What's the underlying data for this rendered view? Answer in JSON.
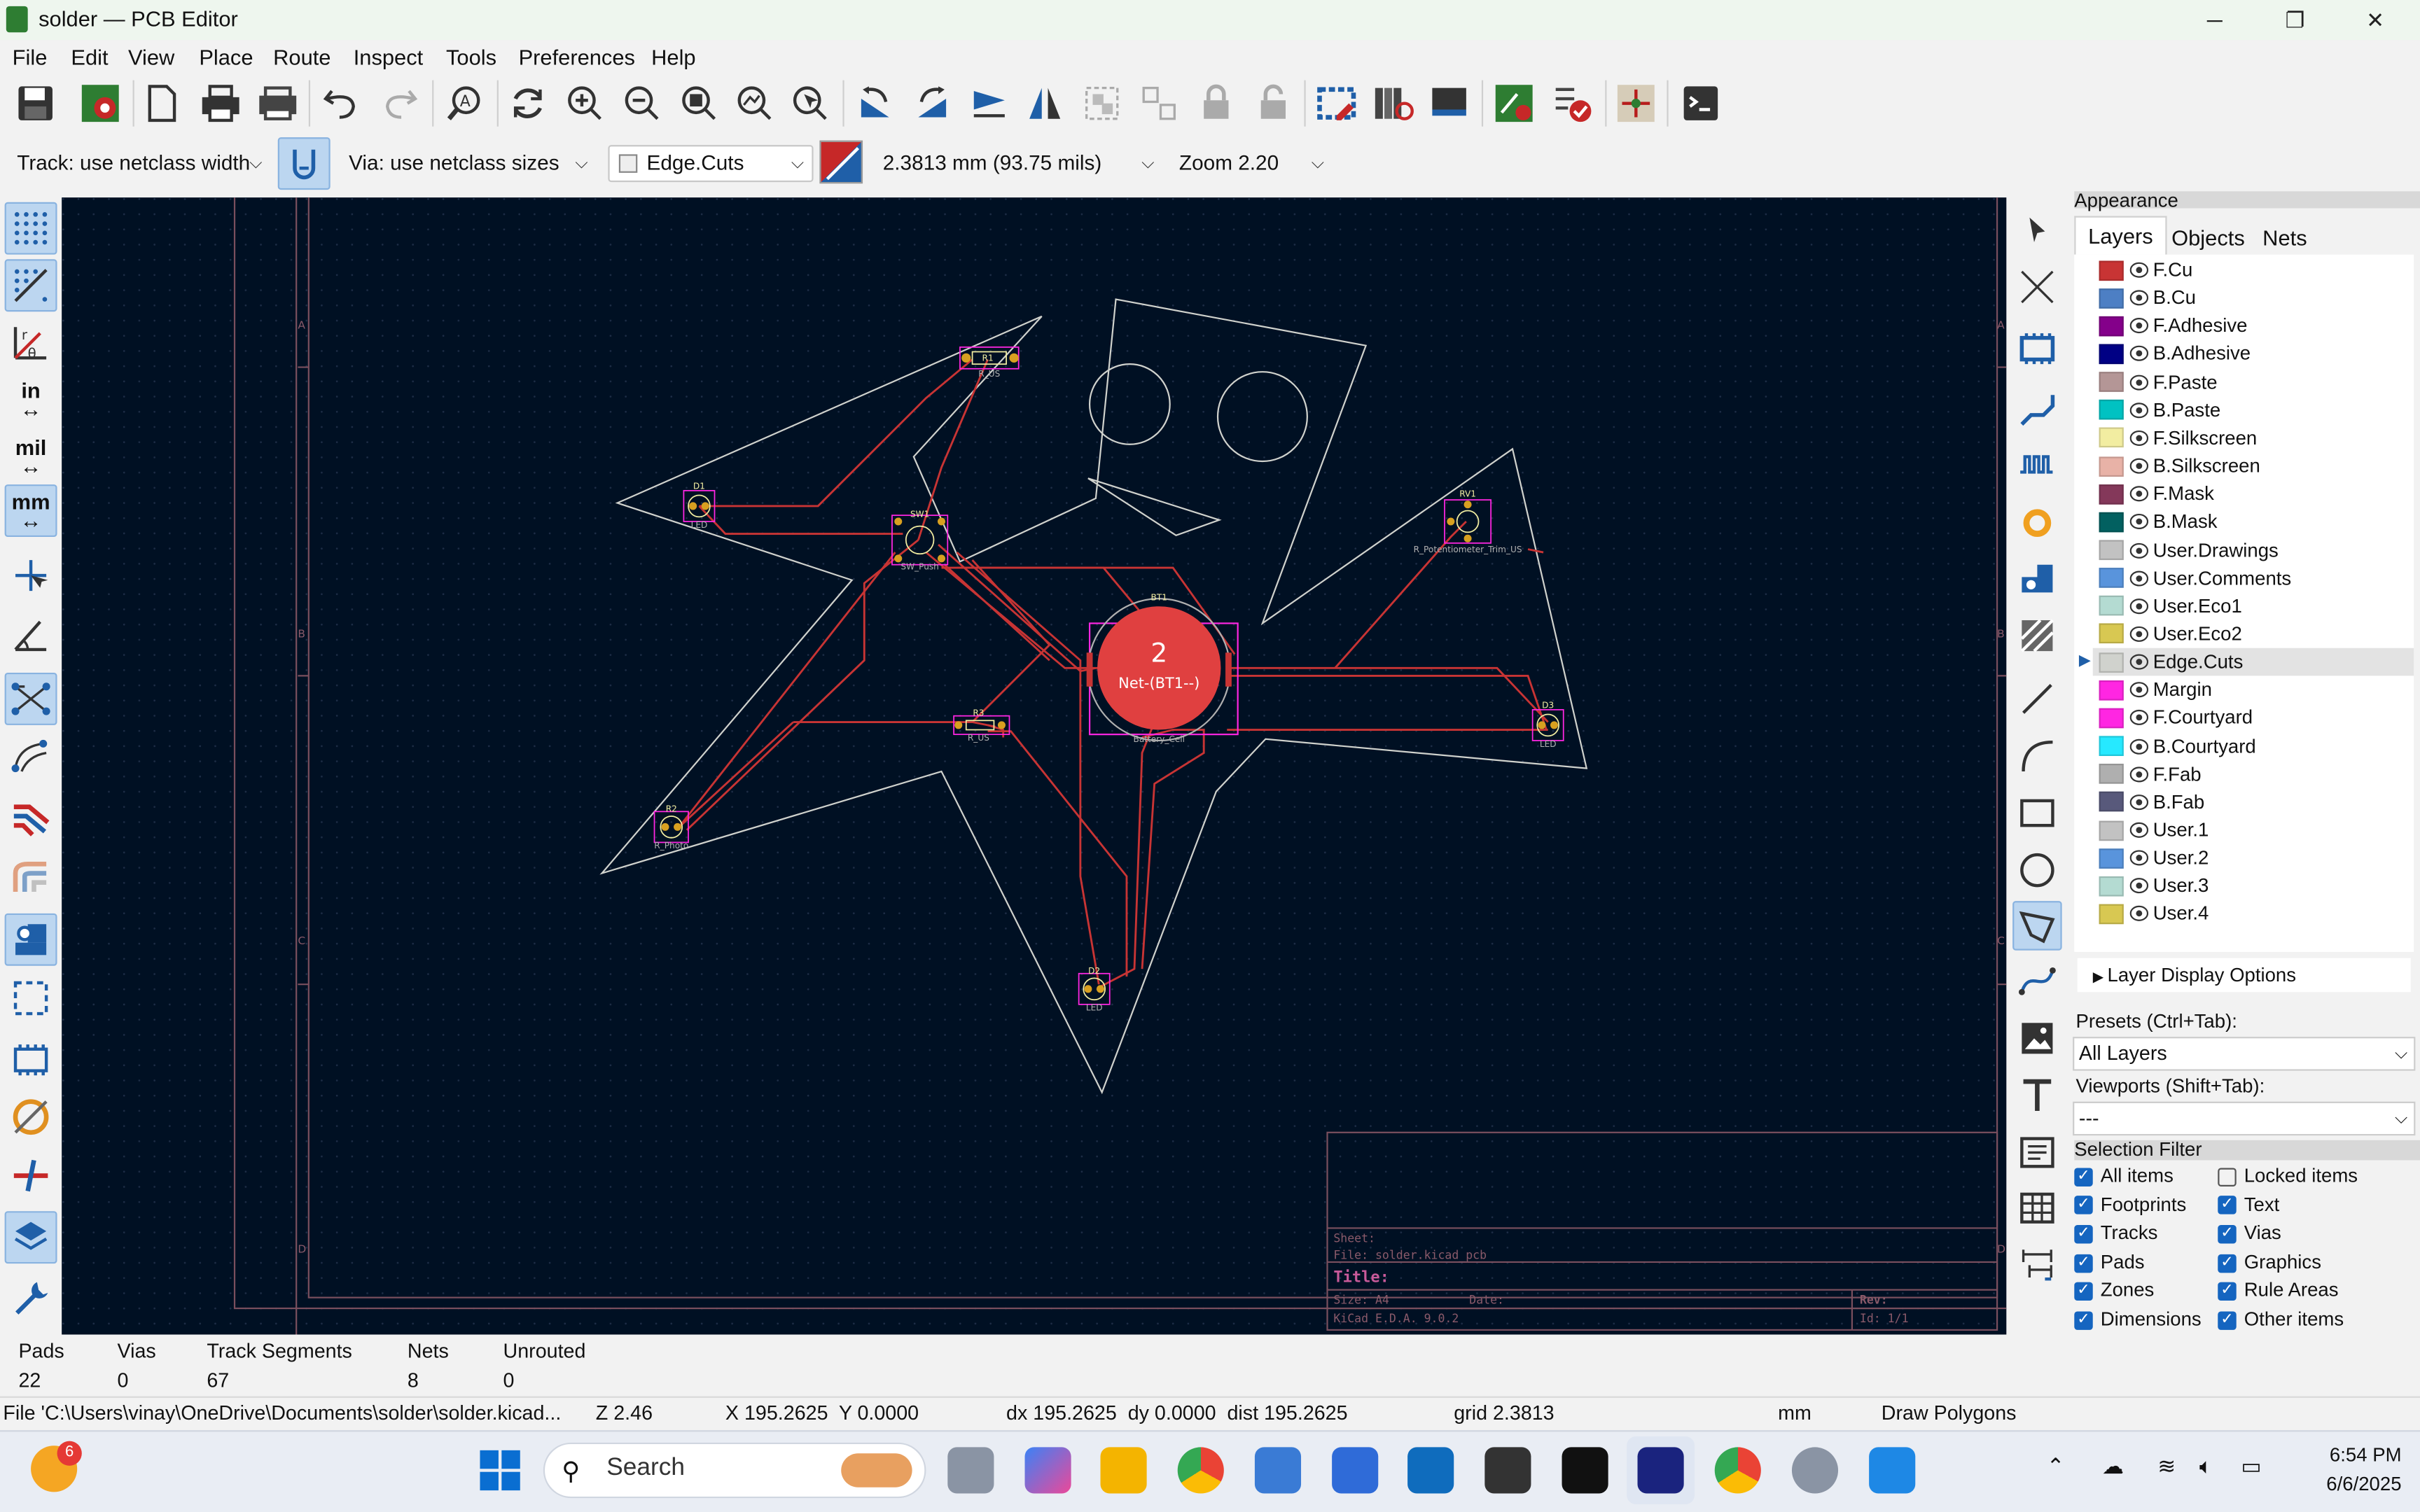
{
  "window": {
    "title": "solder — PCB Editor",
    "minimize": "─",
    "maximize": "❐",
    "close": "✕"
  },
  "menu": [
    "File",
    "Edit",
    "View",
    "Place",
    "Route",
    "Inspect",
    "Tools",
    "Preferences",
    "Help"
  ],
  "toolbar": {
    "track_width": "Track: use netclass width",
    "via_size": "Via: use netclass sizes",
    "layer": "Edge.Cuts",
    "grid": "2.3813 mm (93.75 mils)",
    "zoom": "Zoom 2.20"
  },
  "left_tools": {
    "units_in": "in",
    "units_mil": "mil",
    "units_mm": "mm"
  },
  "board": {
    "refs": {
      "r1": "R1",
      "r1v": "R_US",
      "d1": "D1",
      "d1v": "LED",
      "sw1": "SW1",
      "sw1v": "SW_Push",
      "bt1": "BT1",
      "bt1v": "Battery_Cell",
      "rv1": "RV1",
      "rv1v": "R_Potentiometer_Trim_US",
      "r3": "R3",
      "r3v": "R_US",
      "d3": "D3",
      "d3v": "LED",
      "r2": "R2",
      "r2v": "R_Photo",
      "d2": "D2",
      "d2v": "LED"
    },
    "pad_number": "2",
    "pad_net": "Net-(BT1--)",
    "frame_rows": [
      "A",
      "B",
      "C",
      "D"
    ],
    "titleblock": {
      "sheet": "Sheet:",
      "file": "File: solder.kicad_pcb",
      "title": "Title:",
      "size": "Size: A4",
      "date": "Date:",
      "rev": "Rev:",
      "kicad": "KiCad E.D.A. 9.0.2",
      "id": "Id: 1/1"
    }
  },
  "appearance": {
    "header": "Appearance",
    "tabs": [
      "Layers",
      "Objects",
      "Nets"
    ],
    "layers": [
      {
        "name": "F.Cu",
        "color": "#c83434"
      },
      {
        "name": "B.Cu",
        "color": "#4d7fc4"
      },
      {
        "name": "F.Adhesive",
        "color": "#84008a"
      },
      {
        "name": "B.Adhesive",
        "color": "#000084"
      },
      {
        "name": "F.Paste",
        "color": "#b49696"
      },
      {
        "name": "B.Paste",
        "color": "#00c2c2"
      },
      {
        "name": "F.Silkscreen",
        "color": "#f2eda1"
      },
      {
        "name": "B.Silkscreen",
        "color": "#e8b2a7"
      },
      {
        "name": "F.Mask",
        "color": "#84385a"
      },
      {
        "name": "B.Mask",
        "color": "#026060"
      },
      {
        "name": "User.Drawings",
        "color": "#c2c2c2"
      },
      {
        "name": "User.Comments",
        "color": "#5994dc"
      },
      {
        "name": "User.Eco1",
        "color": "#b4dbd2"
      },
      {
        "name": "User.Eco2",
        "color": "#d8c852"
      },
      {
        "name": "Edge.Cuts",
        "color": "#d0d2cd"
      },
      {
        "name": "Margin",
        "color": "#ff26e2"
      },
      {
        "name": "F.Courtyard",
        "color": "#ff26e2"
      },
      {
        "name": "B.Courtyard",
        "color": "#26e9ff"
      },
      {
        "name": "F.Fab",
        "color": "#afafaf"
      },
      {
        "name": "B.Fab",
        "color": "#58597b"
      },
      {
        "name": "User.1",
        "color": "#c2c2c2"
      },
      {
        "name": "User.2",
        "color": "#5994dc"
      },
      {
        "name": "User.3",
        "color": "#b4dbd2"
      },
      {
        "name": "User.4",
        "color": "#d8c852"
      }
    ],
    "layer_display_options": "Layer Display Options",
    "presets_label": "Presets (Ctrl+Tab):",
    "presets_value": "All Layers",
    "viewports_label": "Viewports (Shift+Tab):",
    "viewports_value": "---",
    "selection_filter": "Selection Filter",
    "filters": [
      {
        "label": "All items",
        "checked": true
      },
      {
        "label": "Locked items",
        "checked": false
      },
      {
        "label": "Footprints",
        "checked": true
      },
      {
        "label": "Text",
        "checked": true
      },
      {
        "label": "Tracks",
        "checked": true
      },
      {
        "label": "Vias",
        "checked": true
      },
      {
        "label": "Pads",
        "checked": true
      },
      {
        "label": "Graphics",
        "checked": true
      },
      {
        "label": "Zones",
        "checked": true
      },
      {
        "label": "Rule Areas",
        "checked": true
      },
      {
        "label": "Dimensions",
        "checked": true
      },
      {
        "label": "Other items",
        "checked": true
      }
    ]
  },
  "stats": {
    "labels": [
      "Pads",
      "Vias",
      "Track Segments",
      "Nets",
      "Unrouted"
    ],
    "values": [
      "22",
      "0",
      "67",
      "8",
      "0"
    ]
  },
  "messages": {
    "file": "File 'C:\\Users\\vinay\\OneDrive\\Documents\\solder\\solder.kicad...",
    "z": "Z 2.46",
    "xy": "X 195.2625  Y 0.0000",
    "delta": "dx 195.2625  dy 0.0000  dist 195.2625",
    "grid": "grid 2.3813",
    "units": "mm",
    "mode": "Draw Polygons"
  },
  "taskbar": {
    "weather_badge": "6",
    "search": "Search",
    "time": "6:54 PM",
    "date": "6/6/2025"
  }
}
